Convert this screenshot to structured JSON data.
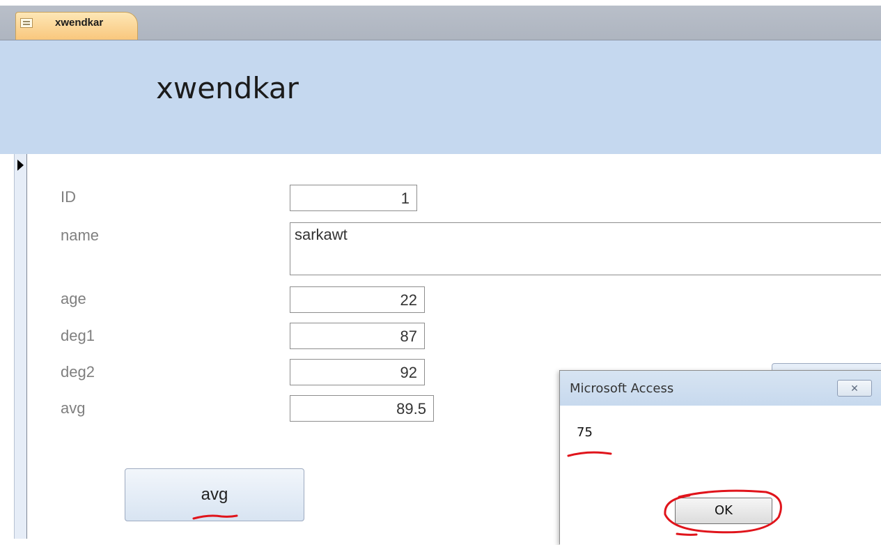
{
  "tab": {
    "label": "xwendkar",
    "icon": "form-icon"
  },
  "form": {
    "title": "xwendkar",
    "fields": {
      "id": {
        "label": "ID",
        "value": "1"
      },
      "name": {
        "label": "name",
        "value": "sarkawt"
      },
      "age": {
        "label": "age",
        "value": "22"
      },
      "deg1": {
        "label": "deg1",
        "value": "87"
      },
      "deg2": {
        "label": "deg2",
        "value": "92"
      },
      "avg": {
        "label": "avg",
        "value": "89.5"
      }
    },
    "avg_button_label": "avg"
  },
  "dialog": {
    "title": "Microsoft Access",
    "message": "75",
    "ok_label": "OK",
    "close_glyph": "✕"
  },
  "colors": {
    "header_bg": "#c5d8ef",
    "tab_bg": "#f9c77d",
    "annotation": "#e0141b"
  }
}
